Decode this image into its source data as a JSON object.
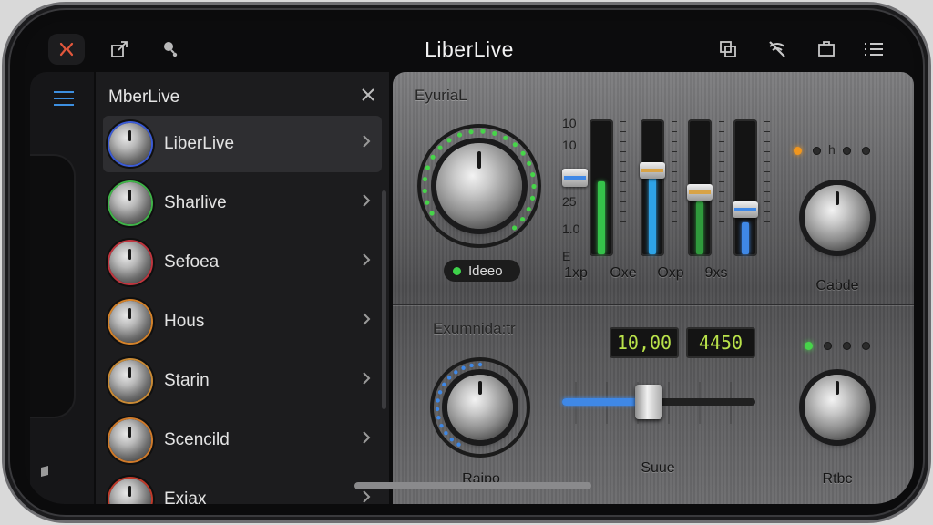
{
  "app": {
    "title": "LiberLive"
  },
  "topbar": {
    "left_icons": [
      "close-x-icon",
      "share-export-icon",
      "microphone-icon"
    ],
    "right_icons": [
      "copy-layers-icon",
      "bluetooth-off-icon",
      "window-icon",
      "list-icon"
    ]
  },
  "rail": {
    "menu_icon": "hamburger-icon"
  },
  "panel": {
    "title": "MberLive",
    "items": [
      {
        "label": "LiberLive",
        "ring": "#3b5bd6",
        "active": true
      },
      {
        "label": "Sharlive",
        "ring": "#3fb348",
        "active": false
      },
      {
        "label": "Sefoea",
        "ring": "#c0353e",
        "active": false
      },
      {
        "label": "Hous",
        "ring": "#d4822a",
        "active": false
      },
      {
        "label": "Starin",
        "ring": "#c98a35",
        "active": false
      },
      {
        "label": "Scencild",
        "ring": "#d07a2a",
        "active": false
      },
      {
        "label": "Exiax",
        "ring": "#c13a2a",
        "active": false
      }
    ]
  },
  "upper": {
    "section_label": "EyuriaL",
    "knob_pill": "Ideeo",
    "scale": [
      "10",
      "10",
      "25",
      "1.0",
      "E"
    ],
    "faders": [
      {
        "label": "1xp",
        "level": 0.55,
        "cap": null,
        "color": "#35c24a"
      },
      {
        "label": "Oxe",
        "level": 0.58,
        "cap": 0.63,
        "color": "#2ea3e6"
      },
      {
        "label": "Oxp",
        "level": 0.4,
        "cap": 0.47,
        "color": "#2f9a3c"
      },
      {
        "label": "9xs",
        "level": 0.24,
        "cap": 0.34,
        "color": "#3f88e6"
      }
    ],
    "first_cap_level": 0.64,
    "right_knob_label": "Cabde",
    "right_knob_marker": "h"
  },
  "lower": {
    "section_label": "Exumnida:tr",
    "lcd_left": "10,00",
    "lcd_right": "4450",
    "left_knob_label": "Raipo",
    "slider_label": "Suue",
    "slider_value": 0.45,
    "right_knob_label": "Rtbc"
  },
  "colors": {
    "green": "#47d44a",
    "blue": "#3f88e6",
    "orange": "#f0961e",
    "lcd": "#b9e24a"
  }
}
